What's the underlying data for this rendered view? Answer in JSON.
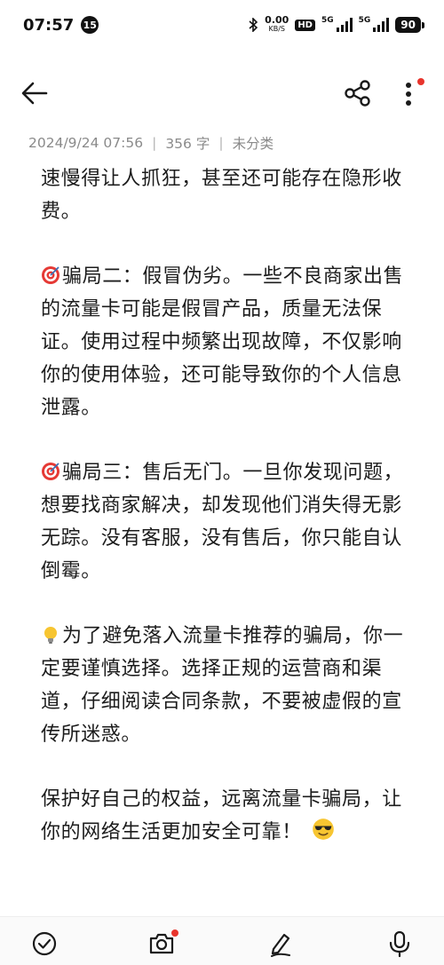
{
  "status_bar": {
    "time": "07:57",
    "notification_count": "15",
    "net_speed": "0.00",
    "net_unit": "KB/S",
    "hd_label": "HD",
    "sim1_label": "5G",
    "sim2_label": "5G",
    "battery": "90"
  },
  "note": {
    "date": "2024/9/24 07:56",
    "word_count": "356 字",
    "category": "未分类",
    "paragraphs": [
      {
        "emoji": "",
        "text": "速慢得让人抓狂，甚至还可能存在隐形收费。"
      },
      {
        "emoji": "target-emoji",
        "text": "骗局二：假冒伪劣。一些不良商家出售的流量卡可能是假冒产品，质量无法保证。使用过程中频繁出现故障，不仅影响你的使用体验，还可能导致你的个人信息泄露。"
      },
      {
        "emoji": "target-emoji",
        "text": "骗局三：售后无门。一旦你发现问题，想要找商家解决，却发现他们消失得无影无踪。没有客服，没有售后，你只能自认倒霉。"
      },
      {
        "emoji": "lightbulb-emoji",
        "text": "为了避免落入流量卡推荐的骗局，你一定要谨慎选择。选择正规的运营商和渠道，仔细阅读合同条款，不要被虚假的宣传所迷惑。"
      },
      {
        "emoji": "sunglasses-emoji",
        "text": "保护好自己的权益，远离流量卡骗局，让你的网络生活更加安全可靠！"
      }
    ]
  },
  "colors": {
    "accent_red": "#e8342c",
    "meta_gray": "#8a8a8a",
    "text": "#1c1c1c"
  },
  "icons": {
    "back": "arrow-left-icon",
    "share": "share-icon",
    "more": "more-vertical-icon",
    "checklist": "check-circle-icon",
    "camera": "camera-icon",
    "handwriting": "pen-icon",
    "voice": "microphone-icon"
  }
}
